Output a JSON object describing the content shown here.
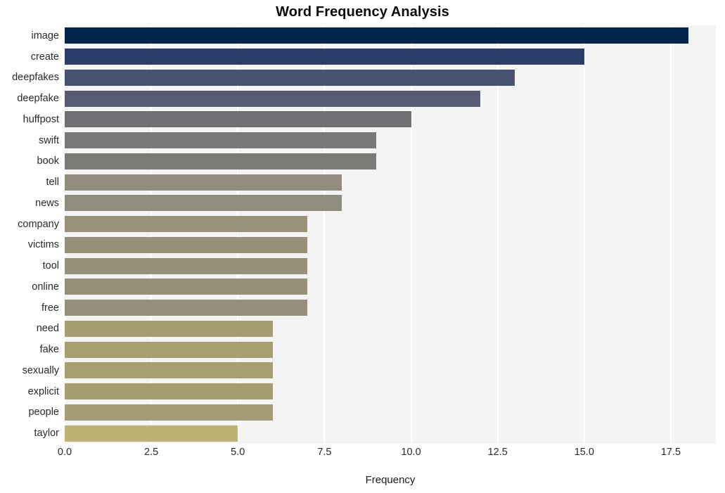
{
  "chart_data": {
    "type": "bar",
    "orientation": "horizontal",
    "title": "Word Frequency Analysis",
    "xlabel": "Frequency",
    "ylabel": "",
    "categories": [
      "image",
      "create",
      "deepfakes",
      "deepfake",
      "huffpost",
      "swift",
      "book",
      "tell",
      "news",
      "company",
      "victims",
      "tool",
      "online",
      "free",
      "need",
      "fake",
      "sexually",
      "explicit",
      "people",
      "taylor"
    ],
    "values": [
      18,
      15,
      13,
      12,
      10,
      9,
      9,
      8,
      8,
      7,
      7,
      7,
      7,
      7,
      6,
      6,
      6,
      6,
      6,
      5
    ],
    "bar_colors": [
      "#03254c",
      "#2c3d6b",
      "#4a5272",
      "#565a73",
      "#6f7073",
      "#787878",
      "#7c7a76",
      "#928d7d",
      "#918d7e",
      "#999279",
      "#98917a",
      "#97907b",
      "#96907b",
      "#958f7c",
      "#a59c70",
      "#a79e6f",
      "#a69d70",
      "#a59d71",
      "#a49c72",
      "#bdb273"
    ],
    "xticks": [
      "0.0",
      "2.5",
      "5.0",
      "7.5",
      "10.0",
      "12.5",
      "15.0",
      "17.5"
    ],
    "xtick_values": [
      0,
      2.5,
      5,
      7.5,
      10,
      12.5,
      15,
      17.5
    ],
    "xlim": [
      0,
      18.8
    ],
    "grid": true,
    "grid_axis": "x",
    "legend": "none",
    "plot_background": "#f4f4f5",
    "figure_background": "#ffffff",
    "gridline_color": "#ffffff"
  }
}
